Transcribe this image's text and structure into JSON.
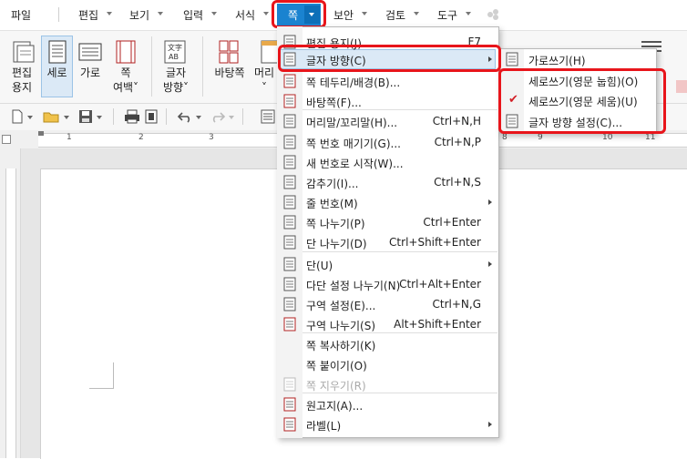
{
  "menubar": {
    "items": [
      {
        "label": "파일"
      },
      {
        "label": "편집"
      },
      {
        "label": "보기"
      },
      {
        "label": "입력"
      },
      {
        "label": "서식"
      },
      {
        "label": "쪽",
        "active": true
      },
      {
        "label": "보안"
      },
      {
        "label": "검토"
      },
      {
        "label": "도구"
      }
    ]
  },
  "ribbon": {
    "buttons": [
      {
        "label1": "편집",
        "label2": "용지"
      },
      {
        "label1": "세로",
        "label2": "",
        "selected": true
      },
      {
        "label1": "가로",
        "label2": ""
      },
      {
        "label1": "쪽",
        "label2": "여백˅"
      },
      {
        "label1": "글자",
        "label2": "방향˅"
      },
      {
        "label1": "바탕쪽",
        "label2": ""
      },
      {
        "label1": "머리",
        "label2": "˅"
      }
    ]
  },
  "ruler": {
    "numbers": [
      "1",
      "2",
      "3",
      "8",
      "9",
      "10",
      "11"
    ]
  },
  "dropdown": {
    "items": [
      {
        "label": "편집 용지(J)...",
        "shortcut": "F7"
      },
      {
        "label": "글자 방향(C)",
        "submenu": true,
        "highlighted": true
      },
      {
        "label": "쪽 테두리/배경(B)..."
      },
      {
        "label": "바탕쪽(F)..."
      },
      {
        "label": "머리말/꼬리말(H)...",
        "shortcut": "Ctrl+N,H"
      },
      {
        "label": "쪽 번호 매기기(G)...",
        "shortcut": "Ctrl+N,P"
      },
      {
        "label": "새 번호로 시작(W)..."
      },
      {
        "label": "감추기(I)...",
        "shortcut": "Ctrl+N,S"
      },
      {
        "label": "줄 번호(M)",
        "submenu": true
      },
      {
        "label": "쪽 나누기(P)",
        "shortcut": "Ctrl+Enter"
      },
      {
        "label": "단 나누기(D)",
        "shortcut": "Ctrl+Shift+Enter"
      },
      {
        "label": "단(U)",
        "submenu": true
      },
      {
        "label": "다단 설정 나누기(N)",
        "shortcut": "Ctrl+Alt+Enter"
      },
      {
        "label": "구역 설정(E)...",
        "shortcut": "Ctrl+N,G"
      },
      {
        "label": "구역 나누기(S)",
        "shortcut": "Alt+Shift+Enter"
      },
      {
        "label": "쪽 복사하기(K)"
      },
      {
        "label": "쪽 붙이기(O)"
      },
      {
        "label": "쪽 지우기(R)",
        "disabled": true
      },
      {
        "label": "원고지(A)..."
      },
      {
        "label": "라벨(L)",
        "submenu": true
      }
    ]
  },
  "submenu": {
    "items": [
      {
        "label": "가로쓰기(H)"
      },
      {
        "label": "세로쓰기(영문 눕힘)(O)"
      },
      {
        "label": "세로쓰기(영문 세움)(U)",
        "checked": true
      },
      {
        "label": "글자 방향 설정(C)..."
      }
    ]
  },
  "colors": {
    "accent": "#1a83d0",
    "highlight_box": "#e8151b",
    "check": "#d21f26"
  }
}
